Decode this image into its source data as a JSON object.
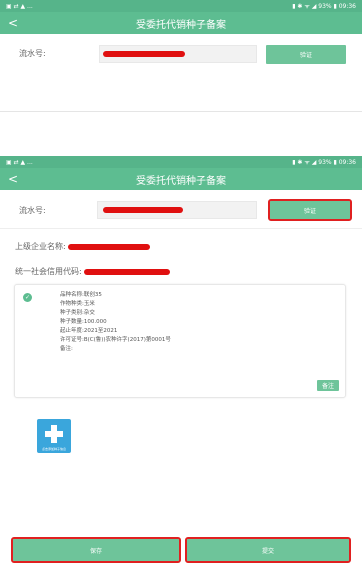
{
  "top": {
    "status_left": "▣ ⇄ ▲ ...",
    "status_right": "▮ ✱ ᯤ ◢ 93% ▮ 09:36",
    "back": "<",
    "title": "受委托代销种子备案",
    "serial_label": "流水号:",
    "verify_label": "验证"
  },
  "bottom": {
    "status_left": "▣ ⇄ ▲ ...",
    "status_right": "▮ ✱ ᯤ ◢ 93% ▮ 09:36",
    "back": "<",
    "title": "受委托代销种子备案",
    "serial_label": "流水号:",
    "verify_label": "验证",
    "company_label": "上级企业名称:",
    "credit_label": "统一社会信用代码:",
    "card_lines": [
      "品种名称:联创35",
      "作物种类:玉米",
      "种子类别:杂交",
      "种子数量:100.000",
      "起止年度:2021至2021",
      "许可证号:B(C(鲁))农种许字(2017)第0001号",
      "备注:"
    ],
    "remark_button": "备注",
    "add_caption": "点击添加种子信息",
    "save_button": "保存",
    "submit_button": "提交"
  },
  "colors": {
    "primary": "#5dbd91",
    "button": "#6ec49a",
    "redaction": "#e01010",
    "highlight": "#e02020",
    "add_tile": "#3aa6dc"
  }
}
